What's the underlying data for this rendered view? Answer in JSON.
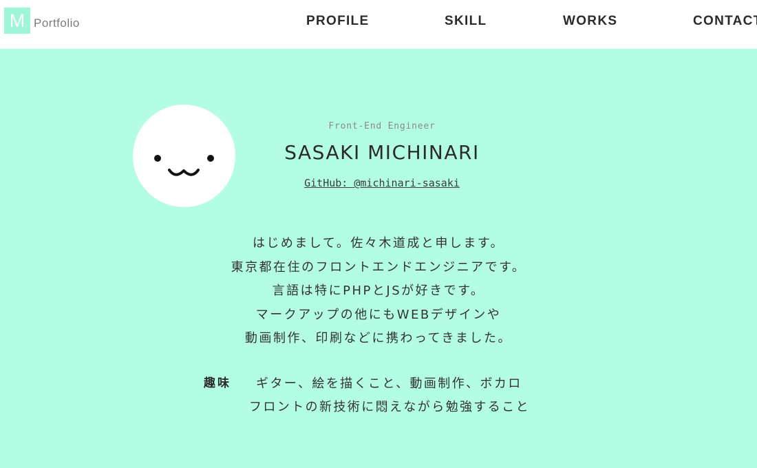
{
  "header": {
    "logo_mark": "M",
    "logo_text": "Portfolio",
    "nav": [
      "PROFILE",
      "SKILL",
      "WORKS",
      "CONTACT"
    ]
  },
  "profile": {
    "job_title": "Front-End Engineer",
    "name": "SASAKI MICHINARI",
    "github_label": "GitHub: @michinari-sasaki"
  },
  "intro": {
    "lines": [
      "はじめまして。佐々木道成と申します。",
      "東京都在住のフロントエンドエンジニアです。",
      "言語は特にPHPとJSが好きです。",
      "マークアップの他にもWEBデザインや",
      "動画制作、印刷などに携わってきました。"
    ]
  },
  "hobby": {
    "label": "趣味",
    "lines": [
      "ギター、絵を描くこと、動画制作、ボカロ",
      "フロントの新技術に悶えながら勉強すること"
    ]
  },
  "colors": {
    "background": "#b3fde4",
    "logo_bg": "#9ff5da",
    "header_bg": "#ffffff",
    "text": "#2b2b2b"
  },
  "icons": {
    "avatar": "smiley-face-icon"
  }
}
